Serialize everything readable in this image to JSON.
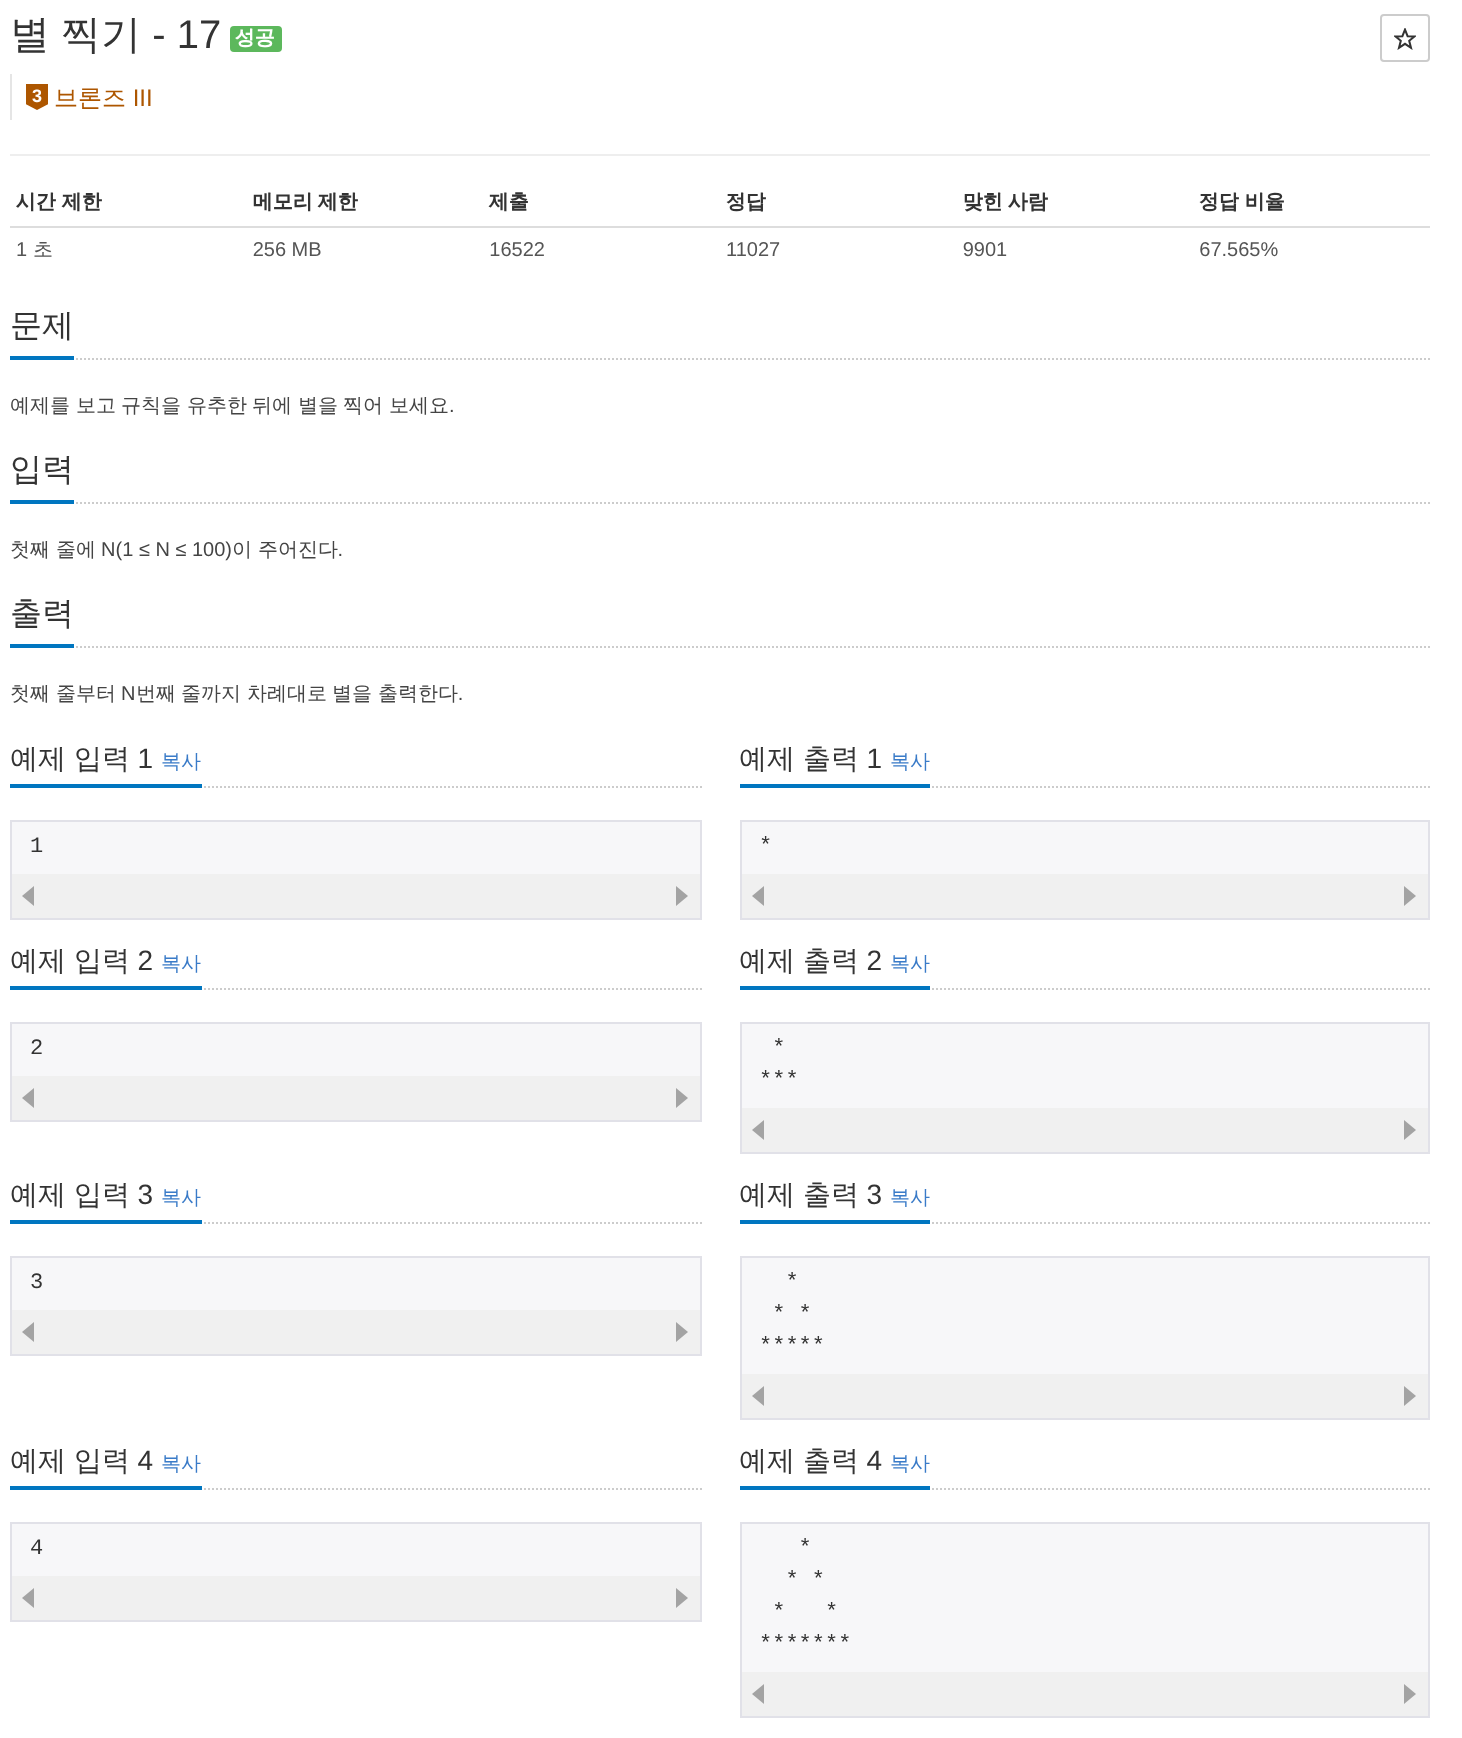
{
  "problem": {
    "title": "별 찍기 - 17",
    "result": "성공",
    "tier": {
      "number": "3",
      "label": "브론즈 III"
    }
  },
  "stats": {
    "columns": [
      "시간 제한",
      "메모리 제한",
      "제출",
      "정답",
      "맞힌 사람",
      "정답 비율"
    ],
    "rows": [
      [
        "1 초",
        "256 MB",
        "16522",
        "11027",
        "9901",
        "67.565%"
      ]
    ]
  },
  "sections": [
    {
      "heading": "문제",
      "text": "예제를 보고 규칙을 유추한 뒤에 별을 찍어 보세요."
    },
    {
      "heading": "입력",
      "text": "첫째 줄에 N(1 ≤ N ≤ 100)이 주어진다."
    },
    {
      "heading": "출력",
      "text": "첫째 줄부터 N번째 줄까지 차례대로 별을 출력한다."
    }
  ],
  "samples": [
    {
      "input": {
        "heading": "예제 입력 1",
        "copy": "복사",
        "data": "1"
      },
      "output": {
        "heading": "예제 출력 1",
        "copy": "복사",
        "data": "*"
      }
    },
    {
      "input": {
        "heading": "예제 입력 2",
        "copy": "복사",
        "data": "2"
      },
      "output": {
        "heading": "예제 출력 2",
        "copy": "복사",
        "data": " *\n***"
      }
    },
    {
      "input": {
        "heading": "예제 입력 3",
        "copy": "복사",
        "data": "3"
      },
      "output": {
        "heading": "예제 출력 3",
        "copy": "복사",
        "data": "  *\n * *\n*****"
      }
    },
    {
      "input": {
        "heading": "예제 입력 4",
        "copy": "복사",
        "data": "4"
      },
      "output": {
        "heading": "예제 출력 4",
        "copy": "복사",
        "data": "   *\n  * *\n *   *\n*******"
      }
    }
  ]
}
